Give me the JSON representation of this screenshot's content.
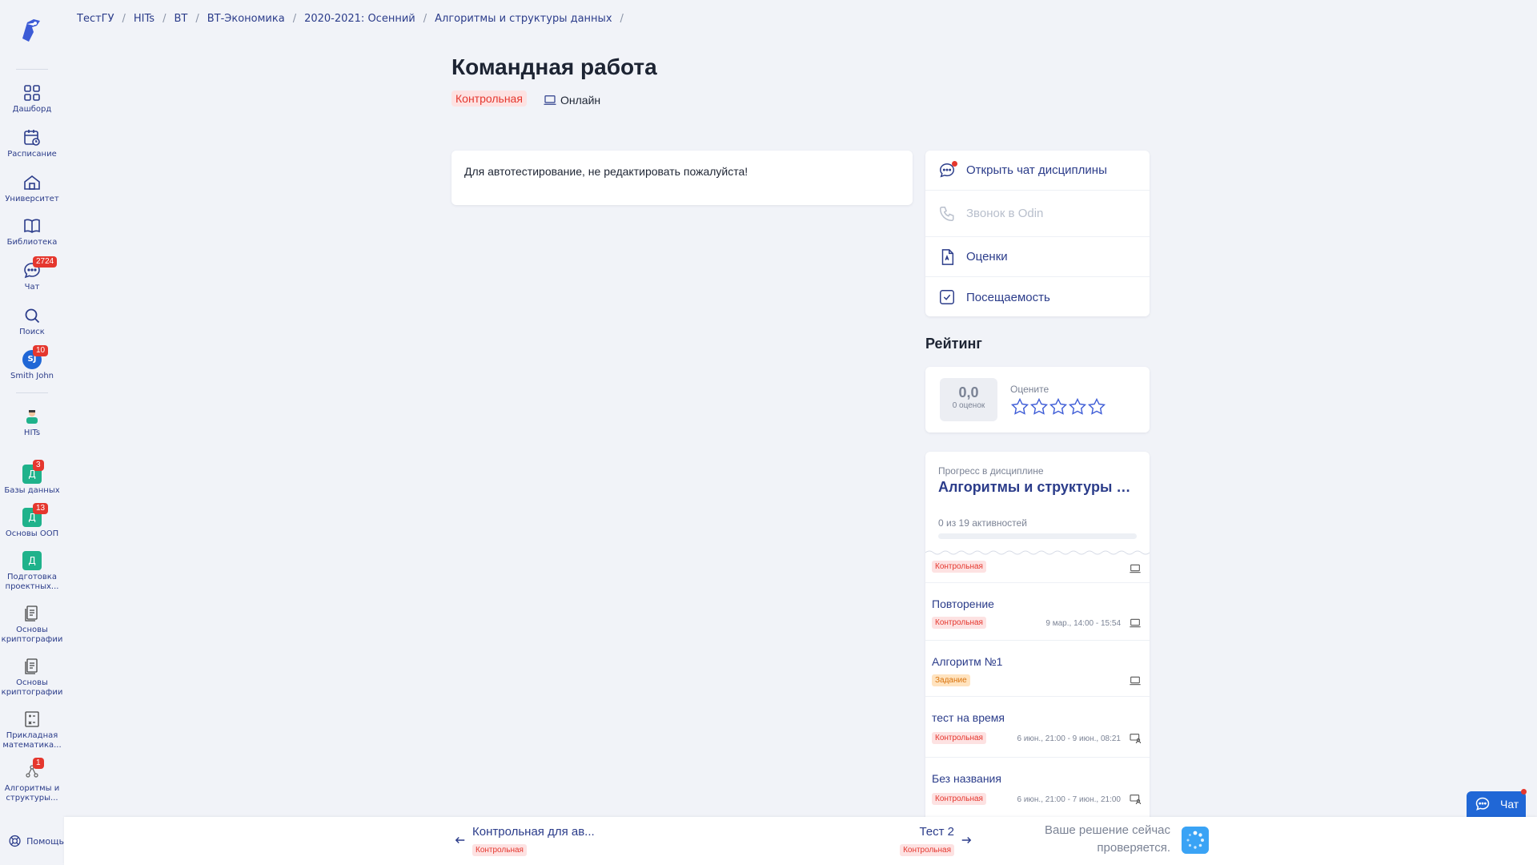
{
  "breadcrumb": [
    "ТестГУ",
    "HITs",
    "ВТ",
    "ВТ-Экономика",
    "2020-2021: Осенний",
    "Алгоритмы и структуры данных"
  ],
  "sidebar": {
    "nav": [
      {
        "label": "Дашборд",
        "icon": "grid-icon"
      },
      {
        "label": "Расписание",
        "icon": "calendar-icon"
      },
      {
        "label": "Университет",
        "icon": "university-icon"
      },
      {
        "label": "Библиотека",
        "icon": "book-icon"
      },
      {
        "label": "Чат",
        "icon": "chat-icon",
        "badge": "2724"
      },
      {
        "label": "Поиск",
        "icon": "search-icon"
      },
      {
        "label": "Smith John",
        "avatar": "SJ",
        "badge": "10"
      }
    ],
    "org": {
      "label": "HITs"
    },
    "courses": [
      {
        "label": "Базы данных",
        "letter": "Д",
        "badge": "3"
      },
      {
        "label": "Основы ООП",
        "letter": "Д",
        "badge": "13"
      },
      {
        "label": "Подготовка проектных...",
        "letter": "Д"
      },
      {
        "label": "Основы криптографии"
      },
      {
        "label": "Основы криптографии"
      },
      {
        "label": "Прикладная математика..."
      },
      {
        "label": "Алгоритмы и структуры...",
        "badge": "1"
      }
    ],
    "help": "Помощь"
  },
  "page": {
    "title": "Командная работа",
    "type_tag": "Контрольная",
    "mode": "Онлайн",
    "description": "Для автотестирование, не редактировать пожалуйста!"
  },
  "actions": [
    {
      "label": "Открыть чат дисциплины",
      "icon": "chat-icon"
    },
    {
      "label": "Звонок в Odin",
      "icon": "phone-icon"
    },
    {
      "label": "Оценки",
      "icon": "grades-icon"
    },
    {
      "label": "Посещаемость",
      "icon": "checkbox-icon"
    }
  ],
  "rating": {
    "title": "Рейтинг",
    "value": "0,0",
    "count": "0 оценок",
    "prompt": "Оцените",
    "stars_max": 5,
    "stars_selected": 0
  },
  "progress": {
    "label": "Прогресс в дисциплине",
    "course": "Алгоритмы и структуры данных",
    "count_text": "0 из 19 активностей",
    "fraction": 0
  },
  "activities": [
    {
      "name": "",
      "tag": "Контрольная",
      "tag_kind": "red",
      "when": "",
      "mode_icon": "laptop-icon"
    },
    {
      "name": "Повторение",
      "tag": "Контрольная",
      "tag_kind": "red",
      "when": "9 мар., 14:00 - 15:54",
      "mode_icon": "laptop-icon"
    },
    {
      "name": "Алгоритм №1",
      "tag": "Задание",
      "tag_kind": "orange",
      "when": "",
      "mode_icon": "laptop-icon"
    },
    {
      "name": "тест на время",
      "tag": "Контрольная",
      "tag_kind": "red",
      "when": "6 июн., 21:00 - 9 июн., 08:21",
      "mode_icon": "classroom-icon"
    },
    {
      "name": "Без названия",
      "tag": "Контрольная",
      "tag_kind": "red",
      "when": "6 июн., 21:00 - 7 июн., 21:00",
      "mode_icon": "classroom-icon"
    }
  ],
  "bottom": {
    "prev_title": "Контрольная для ав...",
    "prev_tag": "Контрольная",
    "next_title": "Тест 2",
    "next_tag": "Контрольная",
    "checking_line1": "Ваше решение сейчас",
    "checking_line2": "проверяется."
  },
  "chat_button": "Чат",
  "colors": {
    "accent": "#2b3c8a",
    "danger": "#e5372e",
    "course": "#1fb28b",
    "chat": "#2067d6"
  }
}
